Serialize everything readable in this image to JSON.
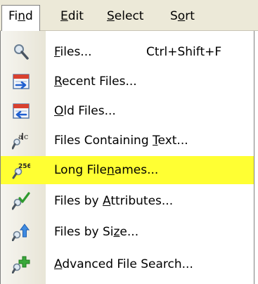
{
  "menubar": {
    "items": [
      {
        "pre": "Fi",
        "key": "n",
        "post": "d"
      },
      {
        "pre": "",
        "key": "E",
        "post": "dit"
      },
      {
        "pre": "",
        "key": "S",
        "post": "elect"
      },
      {
        "pre": "S",
        "key": "o",
        "post": "rt"
      }
    ]
  },
  "menu": {
    "items": [
      {
        "pre": "",
        "key": "F",
        "post": "iles...",
        "shortcut": "Ctrl+Shift+F",
        "icon": "magnifier-icon"
      },
      {
        "pre": "",
        "key": "R",
        "post": "ecent Files...",
        "shortcut": "",
        "icon": "recent-files-icon"
      },
      {
        "pre": "",
        "key": "O",
        "post": "ld Files...",
        "shortcut": "",
        "icon": "old-files-icon"
      },
      {
        "pre": "Files Containing ",
        "key": "T",
        "post": "ext...",
        "shortcut": "",
        "icon": "text-search-icon"
      },
      {
        "pre": "Long File",
        "key": "n",
        "post": "ames...",
        "shortcut": "",
        "icon": "long-filename-icon",
        "highlighted": true
      },
      {
        "pre": "Files by ",
        "key": "A",
        "post": "ttributes...",
        "shortcut": "",
        "icon": "attributes-icon"
      },
      {
        "pre": "Files by Si",
        "key": "z",
        "post": "e...",
        "shortcut": "",
        "icon": "size-icon"
      },
      {
        "pre": "",
        "key": "A",
        "post": "dvanced File Search...",
        "shortcut": "",
        "icon": "advanced-search-icon"
      }
    ]
  },
  "colors": {
    "highlight": "#ffff33",
    "menubar": "#ece9d8"
  }
}
